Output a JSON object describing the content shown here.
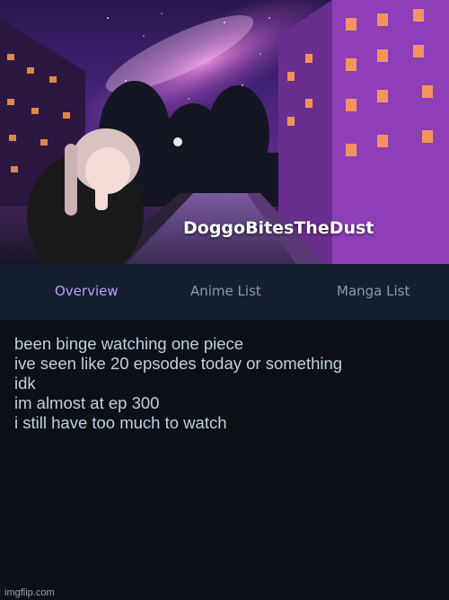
{
  "profile": {
    "username": "DoggoBitesTheDust"
  },
  "tabs": [
    {
      "label": "Overview",
      "active": true
    },
    {
      "label": "Anime List",
      "active": false
    },
    {
      "label": "Manga List",
      "active": false
    }
  ],
  "post": {
    "lines": [
      "been binge watching one piece",
      "ive seen like 20 epsodes today or something",
      "idk",
      "im almost at ep 300",
      "i still have too much to watch"
    ]
  },
  "watermark": "imgflip.com",
  "colors": {
    "accent": "#b7a3ff",
    "tab_inactive": "#8a9bb3",
    "tabs_background": "#151f2e",
    "page_background": "#0c1118",
    "post_text": "#c2cfe0"
  }
}
